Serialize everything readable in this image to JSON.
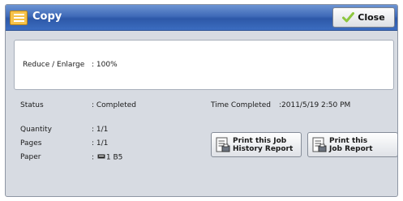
{
  "header": {
    "title": "Copy",
    "close_label": "Close"
  },
  "setting": {
    "label": "Reduce / Enlarge",
    "value": ": 100%"
  },
  "details": {
    "status_label": "Status",
    "status_value": ": Completed",
    "time_label": "Time Completed",
    "time_value": ":2011/5/19 2:50 PM",
    "quantity_label": "Quantity",
    "quantity_value": ": 1/1",
    "pages_label": "Pages",
    "pages_value": ": 1/1",
    "paper_label": "Paper",
    "paper_value": ": ",
    "paper_tray": "1 B5"
  },
  "buttons": {
    "history_line1": "Print this Job",
    "history_line2": "History Report",
    "report_line1": "Print this",
    "report_line2": "Job Report"
  },
  "icons": {
    "app": "copy-icon",
    "close": "check-icon",
    "history": "document-print-icon",
    "report": "document-print-icon",
    "tray": "paper-tray-icon"
  },
  "colors": {
    "titlebar": "#3f6ab8",
    "panel": "#d7dbe2",
    "app_icon": "#f6c24a",
    "check": "#8dc63f"
  }
}
